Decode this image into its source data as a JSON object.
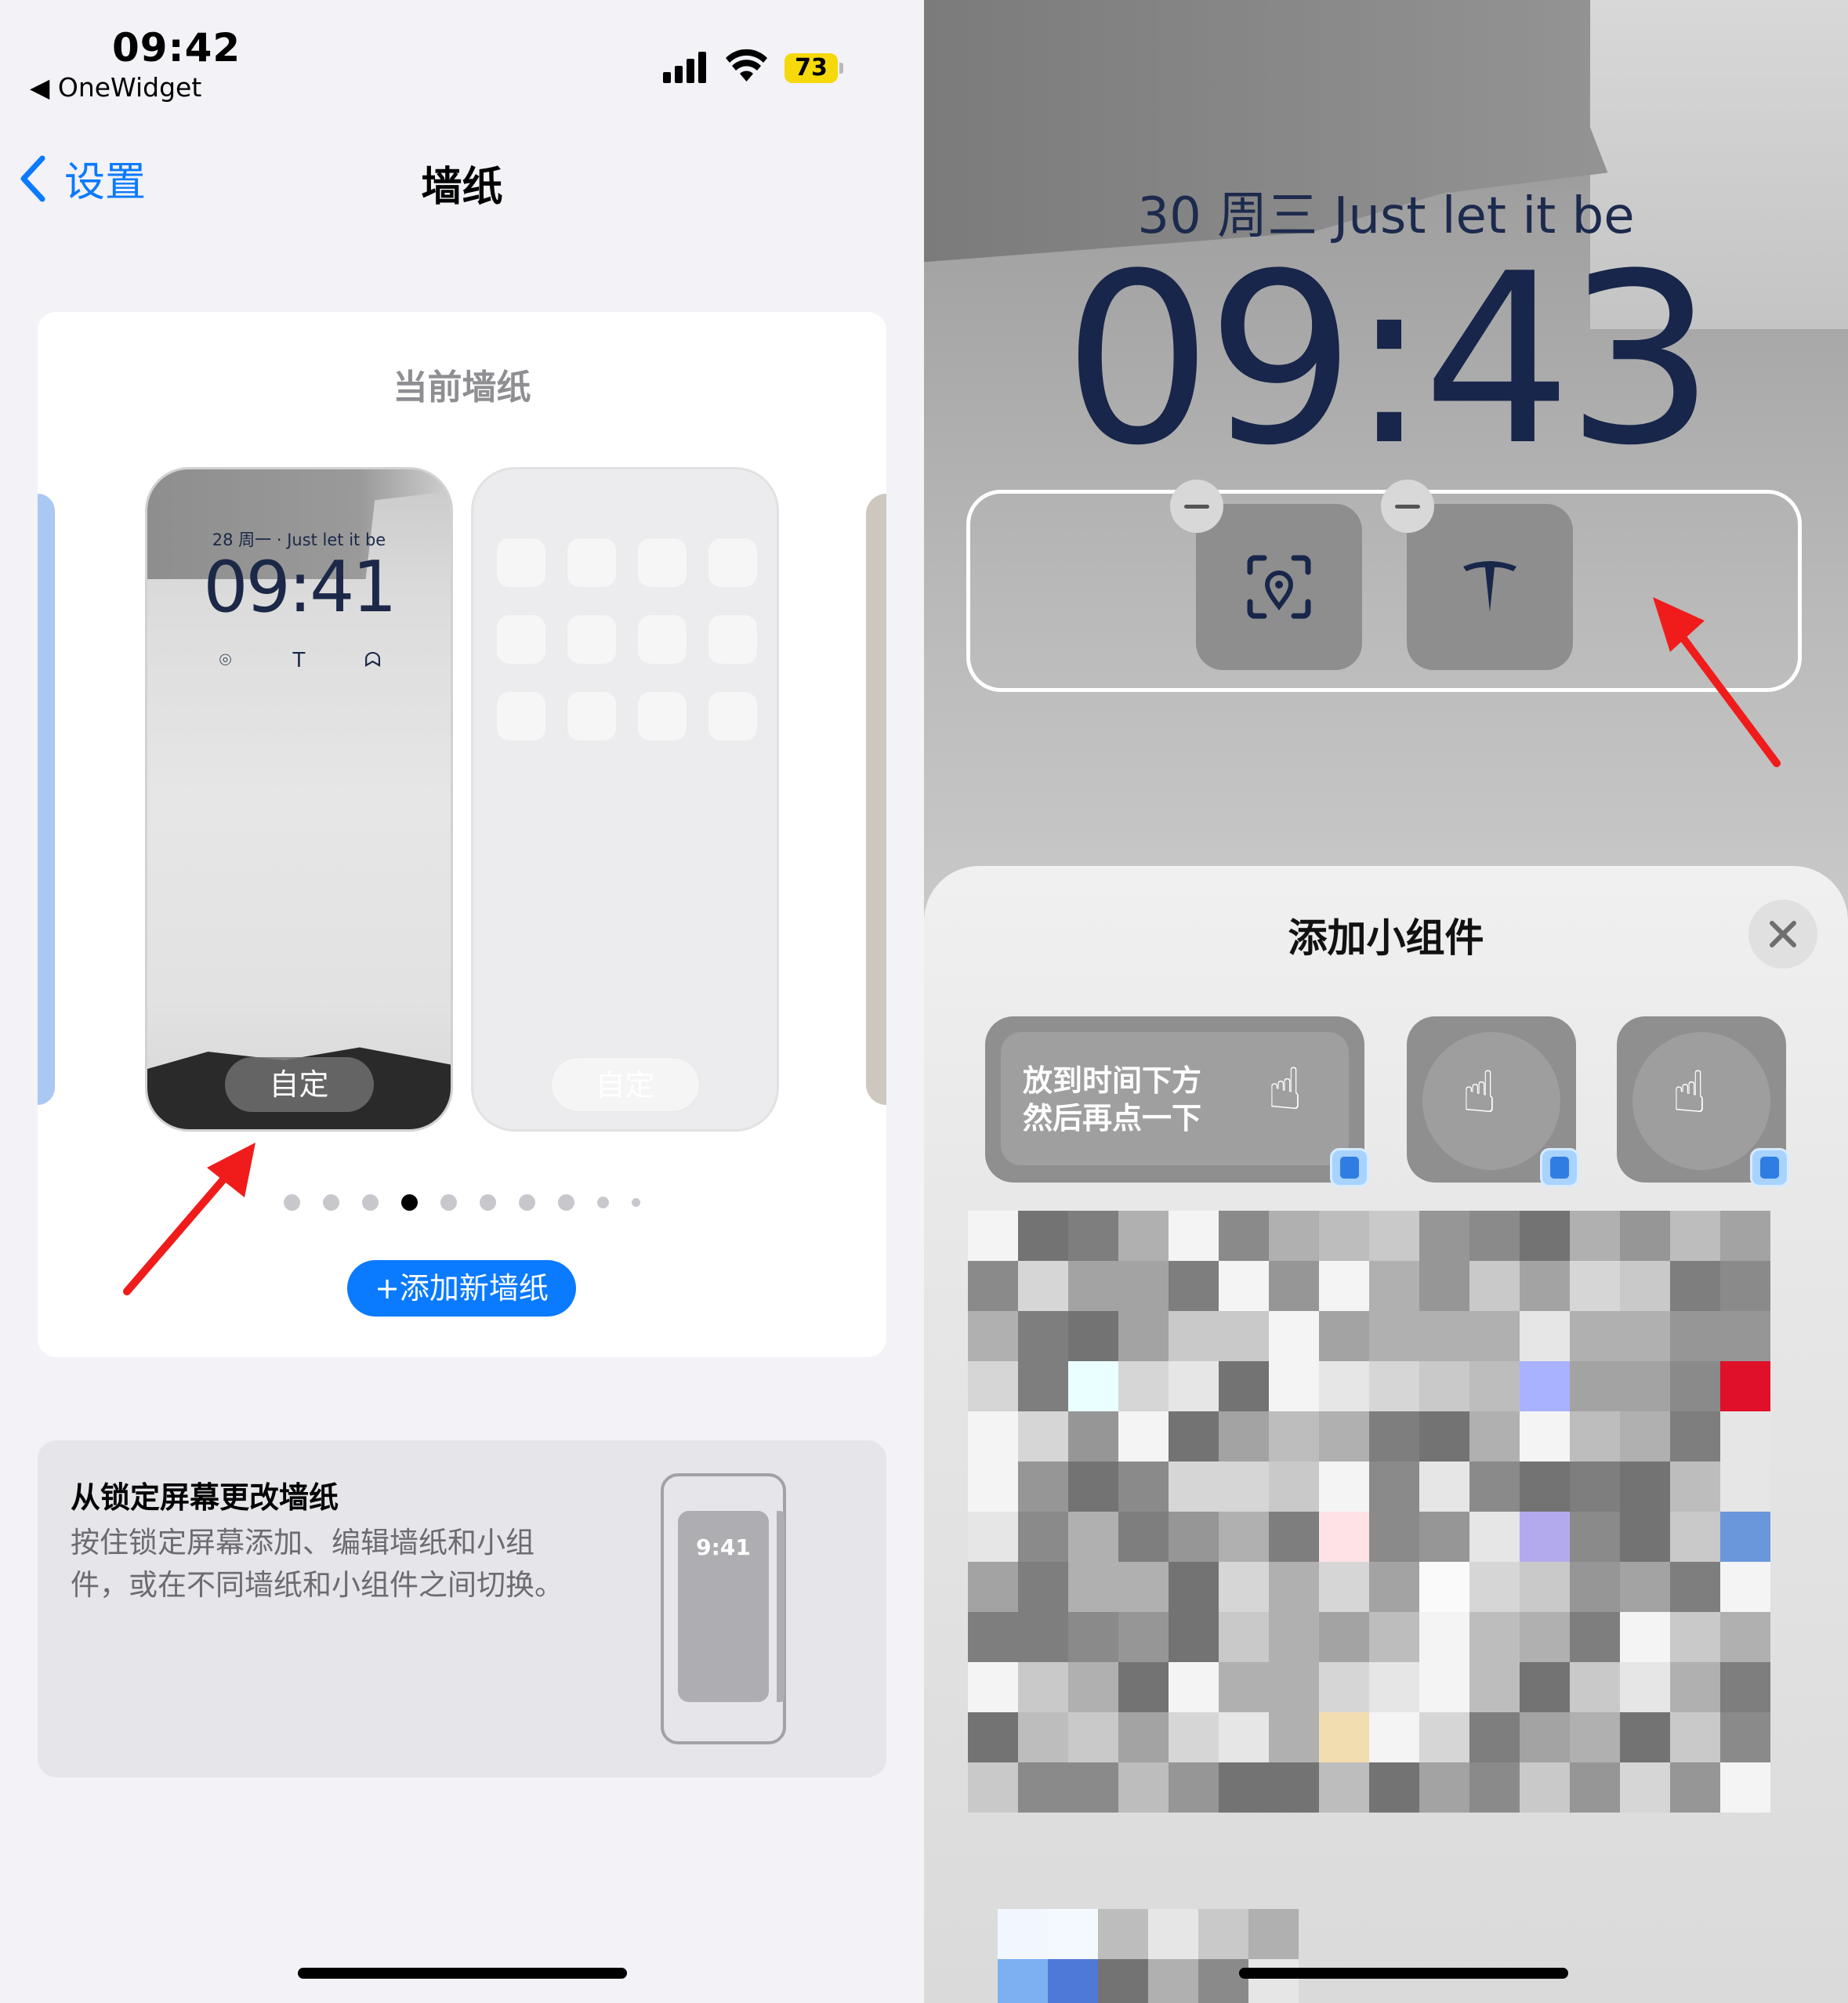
{
  "left": {
    "status_bar": {
      "time": "09:42",
      "back_app": "◀ OneWidget",
      "battery": "73"
    },
    "nav": {
      "back_label": "设置",
      "title": "墙纸"
    },
    "current_card": {
      "title": "当前墙纸",
      "lock_preview": {
        "date": "28 周一 · Just let it be",
        "time": "09:41",
        "custom_label": "自定"
      },
      "home_preview": {
        "custom_label": "自定"
      },
      "page_count": 10,
      "active_page": 3,
      "add_button": "+添加新墙纸"
    },
    "info_card": {
      "title": "从锁定屏幕更改墙纸",
      "description": "按住锁定屏幕添加、编辑墙纸和小组件，或在不同墙纸和小组件之间切换。",
      "phone_time": "9:41"
    }
  },
  "right": {
    "lock": {
      "date_line": "30 周三  Just let it be",
      "time": "09:43"
    },
    "widgets": [
      "location-scan-icon",
      "tesla-icon"
    ],
    "sheet": {
      "title": "添加小组件",
      "large_widget_text_line1": "放到时间下方",
      "large_widget_text_line2": "然后再点一下"
    }
  },
  "colors": {
    "accent": "#0a7aff",
    "arrow": "#f01c1c",
    "lock_text": "#17264a",
    "battery": "#f5d90a"
  }
}
